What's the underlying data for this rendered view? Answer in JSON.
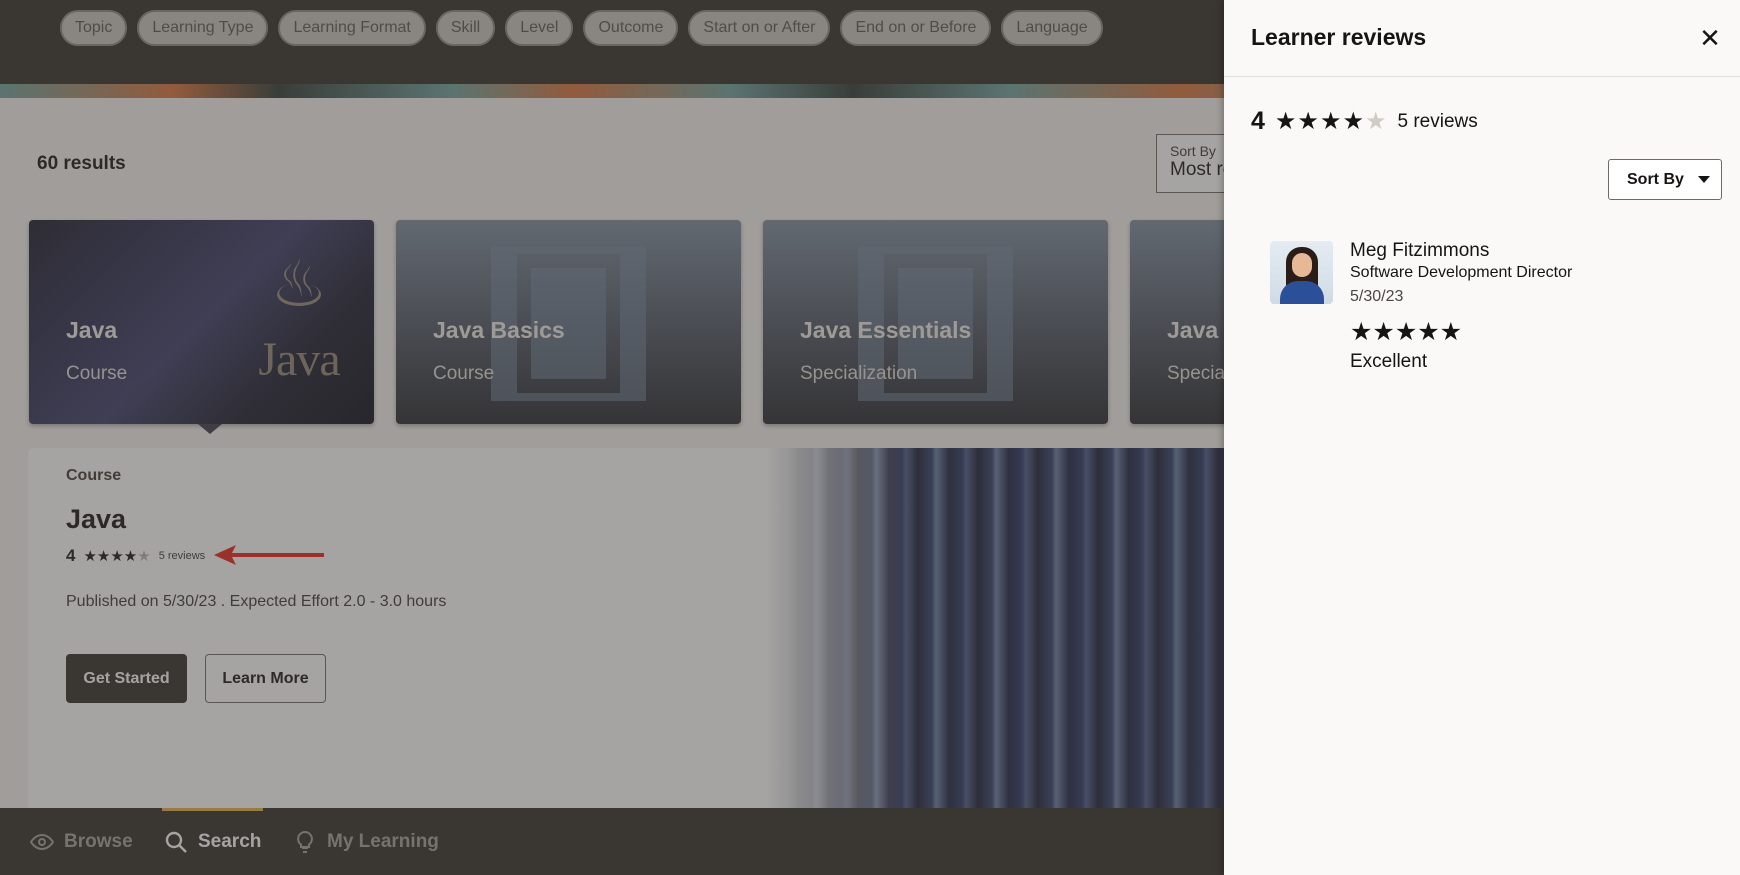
{
  "filters": [
    "Topic",
    "Learning Type",
    "Learning Format",
    "Skill",
    "Level",
    "Outcome",
    "Start on or After",
    "End on or Before",
    "Language"
  ],
  "results": {
    "count_label": "60 results"
  },
  "sort": {
    "label": "Sort By",
    "value": "Most re"
  },
  "cards": [
    {
      "title": "Java",
      "type": "Course",
      "logo_text": "Java"
    },
    {
      "title": "Java Basics",
      "type": "Course"
    },
    {
      "title": "Java Essentials",
      "type": "Specialization"
    },
    {
      "title": "Java C",
      "type": "Special"
    }
  ],
  "detail": {
    "type": "Course",
    "title": "Java",
    "rating": "4",
    "rating_value": 4,
    "reviews_label": "5 reviews",
    "meta": "Published on 5/30/23  .  Expected Effort 2.0 - 3.0 hours",
    "primary_button": "Get Started",
    "secondary_button": "Learn More"
  },
  "nav": [
    {
      "label": "Browse",
      "icon": "eye-icon",
      "active": false
    },
    {
      "label": "Search",
      "icon": "search-icon",
      "active": true
    },
    {
      "label": "My Learning",
      "icon": "lightbulb-icon",
      "active": false
    }
  ],
  "drawer": {
    "title": "Learner reviews",
    "close_icon": "close-icon",
    "rating": "4",
    "rating_value": 4,
    "reviews_label": "5 reviews",
    "sort_label": "Sort By",
    "reviews": [
      {
        "name": "Meg Fitzimmons",
        "role": "Software Development Director",
        "date": "5/30/23",
        "stars": 5,
        "text": "Excellent"
      }
    ]
  },
  "colors": {
    "dark": "#312d2a",
    "accent": "#e1b04a",
    "annotation_arrow": "#e8231a"
  }
}
